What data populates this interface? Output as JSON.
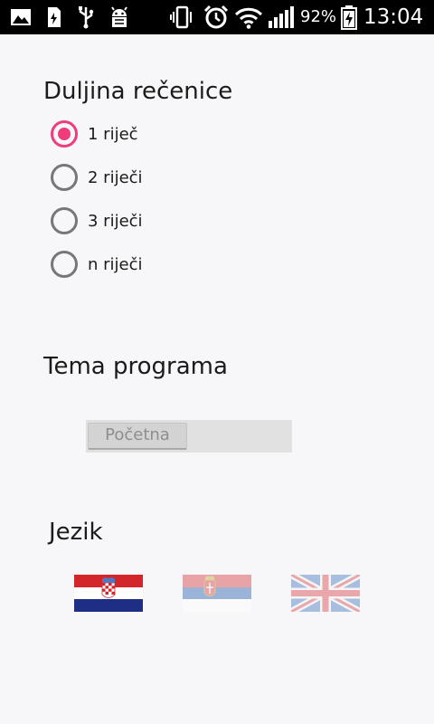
{
  "status_bar": {
    "battery_percent": "92%",
    "time": "13:04",
    "icons": [
      "gallery-icon",
      "sd-card-icon",
      "usb-icon",
      "android-debug-icon",
      "vibrate-icon",
      "alarm-icon",
      "wifi-icon",
      "signal-icon",
      "battery-charging-icon"
    ]
  },
  "sentence_length": {
    "title": "Duljina rečenice",
    "options": [
      {
        "label": "1 riječ",
        "checked": true
      },
      {
        "label": "2 riječi",
        "checked": false
      },
      {
        "label": "3 riječi",
        "checked": false
      },
      {
        "label": "n riječi",
        "checked": false
      }
    ]
  },
  "theme": {
    "title": "Tema programa",
    "selected": "Početna"
  },
  "language": {
    "title": "Jezik",
    "flags": [
      {
        "icon": "croatia-flag-icon",
        "selected": true
      },
      {
        "icon": "serbia-flag-icon",
        "selected": false
      },
      {
        "icon": "uk-flag-icon",
        "selected": false
      }
    ]
  },
  "colors": {
    "accent": "#ee3d7a",
    "radio_unchecked": "#777777",
    "background": "#f7f7f9"
  }
}
